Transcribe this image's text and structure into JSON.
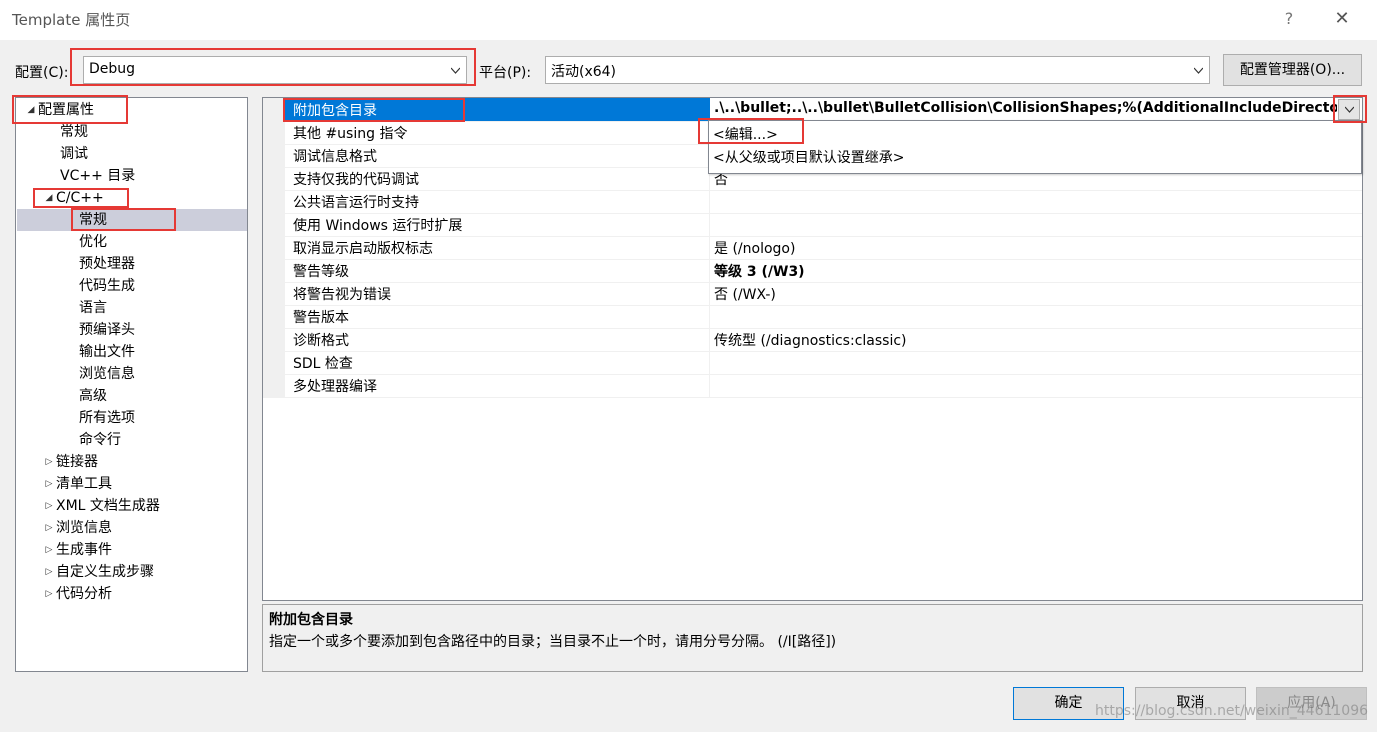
{
  "window": {
    "title": "Template 属性页",
    "help_label": "?",
    "close_label": "✕"
  },
  "config": {
    "config_label": "配置(C):",
    "config_value": "Debug",
    "platform_label": "平台(P):",
    "platform_value": "活动(x64)",
    "manager_button": "配置管理器(O)..."
  },
  "tree": {
    "items": [
      {
        "label": "配置属性",
        "arrow": "◢"
      },
      {
        "label": "常规"
      },
      {
        "label": "调试"
      },
      {
        "label": "VC++ 目录"
      },
      {
        "label": "C/C++",
        "arrow": "◢"
      },
      {
        "label": "常规",
        "selected": true
      },
      {
        "label": "优化"
      },
      {
        "label": "预处理器"
      },
      {
        "label": "代码生成"
      },
      {
        "label": "语言"
      },
      {
        "label": "预编译头"
      },
      {
        "label": "输出文件"
      },
      {
        "label": "浏览信息"
      },
      {
        "label": "高级"
      },
      {
        "label": "所有选项"
      },
      {
        "label": "命令行"
      },
      {
        "label": "链接器",
        "arrow": "▷"
      },
      {
        "label": "清单工具",
        "arrow": "▷"
      },
      {
        "label": "XML 文档生成器",
        "arrow": "▷"
      },
      {
        "label": "浏览信息",
        "arrow": "▷"
      },
      {
        "label": "生成事件",
        "arrow": "▷"
      },
      {
        "label": "自定义生成步骤",
        "arrow": "▷"
      },
      {
        "label": "代码分析",
        "arrow": "▷"
      }
    ]
  },
  "grid": {
    "rows": [
      {
        "name": "附加包含目录",
        "value": ".\\..\\bullet;..\\..\\bullet\\BulletCollision\\CollisionShapes;%(AdditionalIncludeDirectories)",
        "selected": true,
        "bold": true
      },
      {
        "name": "其他 #using 指令",
        "value": ""
      },
      {
        "name": "调试信息格式",
        "value": ""
      },
      {
        "name": "支持仅我的代码调试",
        "value": "否"
      },
      {
        "name": "公共语言运行时支持",
        "value": ""
      },
      {
        "name": "使用 Windows 运行时扩展",
        "value": ""
      },
      {
        "name": "取消显示启动版权标志",
        "value": "是 (/nologo)"
      },
      {
        "name": "警告等级",
        "value": "等级 3 (/W3)",
        "bold": true
      },
      {
        "name": "将警告视为错误",
        "value": "否 (/WX-)"
      },
      {
        "name": "警告版本",
        "value": ""
      },
      {
        "name": "诊断格式",
        "value": "传统型 (/diagnostics:classic)"
      },
      {
        "name": "SDL 检查",
        "value": ""
      },
      {
        "name": "多处理器编译",
        "value": ""
      }
    ],
    "dropdown": {
      "items": [
        "<编辑...>",
        "<从父级或项目默认设置继承>"
      ]
    }
  },
  "description": {
    "title": "附加包含目录",
    "text": "指定一个或多个要添加到包含路径中的目录；当目录不止一个时，请用分号分隔。     (/I[路径])"
  },
  "buttons": {
    "ok": "确定",
    "cancel": "取消",
    "apply": "应用(A)"
  },
  "watermark": "https://blog.csdn.net/weixin_44611096",
  "colors": {
    "accent": "#0078d7",
    "highlight_box": "#e53935",
    "tree_selection": "#cccedb"
  }
}
